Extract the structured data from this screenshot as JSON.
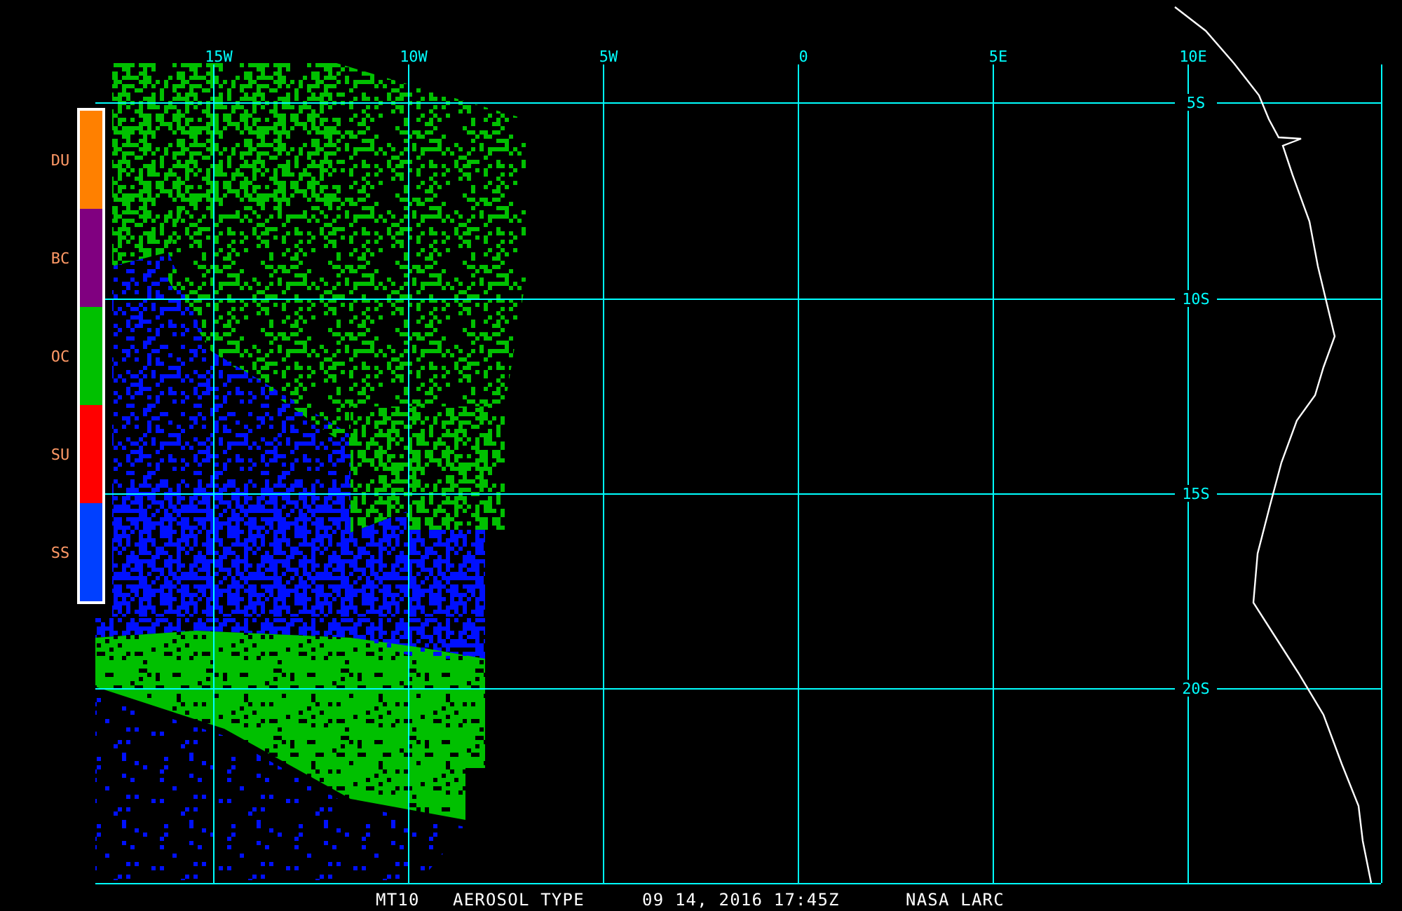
{
  "map": {
    "longitude_labels": [
      "15W",
      "10W",
      "5W",
      "0",
      "5E",
      "10E"
    ],
    "latitude_labels": [
      "5S",
      "10S",
      "15S",
      "20S"
    ]
  },
  "legend": {
    "items": [
      {
        "label": "DU",
        "color": "#ff8000"
      },
      {
        "label": "BC",
        "color": "#800080"
      },
      {
        "label": "OC",
        "color": "#00c000"
      },
      {
        "label": "SU",
        "color": "#ff0000"
      },
      {
        "label": "SS",
        "color": "#0040ff"
      }
    ]
  },
  "caption": {
    "product": "MT10",
    "title": "AEROSOL TYPE",
    "date_time": "09 14, 2016 17:45Z",
    "source": "NASA LARC"
  }
}
